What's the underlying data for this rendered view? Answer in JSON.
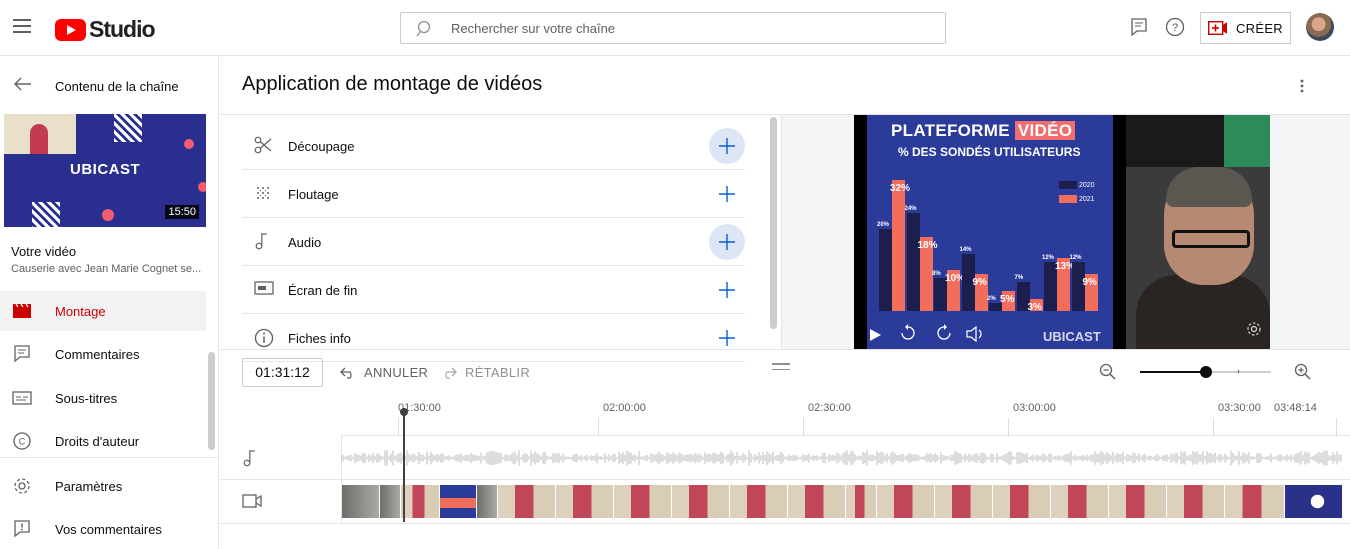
{
  "header": {
    "logo_text": "Studio",
    "search_placeholder": "Rechercher sur votre chaîne",
    "create_label": "CRÉER"
  },
  "sidebar": {
    "back_label": "Contenu de la chaîne",
    "thumbnail": {
      "logo_text": "UBICAST",
      "duration": "15:50"
    },
    "video_label": "Votre vidéo",
    "video_name": "Causerie avec Jean Marie Cognet se...",
    "items": [
      {
        "label": "Montage",
        "icon": "clapper-icon",
        "active": true
      },
      {
        "label": "Commentaires",
        "icon": "comment-icon"
      },
      {
        "label": "Sous-titres",
        "icon": "subtitles-icon"
      },
      {
        "label": "Droits d'auteur",
        "icon": "copyright-icon"
      },
      {
        "label": "Paramètres",
        "icon": "gear-icon"
      },
      {
        "label": "Vos commentaires",
        "icon": "feedback-icon"
      }
    ]
  },
  "main": {
    "title": "Application de montage de vidéos",
    "tools": [
      {
        "label": "Découpage",
        "icon": "scissors-icon",
        "highlighted": true
      },
      {
        "label": "Floutage",
        "icon": "blur-icon",
        "highlighted": false
      },
      {
        "label": "Audio",
        "icon": "music-note-icon",
        "highlighted": true
      },
      {
        "label": "Écran de fin",
        "icon": "end-screen-icon",
        "highlighted": false
      },
      {
        "label": "Fiches info",
        "icon": "info-icon",
        "highlighted": false
      }
    ]
  },
  "preview": {
    "slide_title_a": "PLATEFORME",
    "slide_title_b": "VIDÉO",
    "slide_subtitle": "% DES SONDÉS UTILISATEURS",
    "legend": [
      "2020",
      "2021"
    ],
    "bars": [
      {
        "v2020": 20,
        "v2021": 32
      },
      {
        "v2020": 24,
        "v2021": 18
      },
      {
        "v2020": 8,
        "v2021": 10
      },
      {
        "v2020": 14,
        "v2021": 9
      },
      {
        "v2020": 2,
        "v2021": 5
      },
      {
        "v2020": 7,
        "v2021": 3
      },
      {
        "v2020": 12,
        "v2021": 13
      },
      {
        "v2020": 12,
        "v2021": 9
      }
    ],
    "watermark": "UBICAST"
  },
  "timeline": {
    "timecode": "01:31:12",
    "undo_label": "ANNULER",
    "redo_label": "RÉTABLIR",
    "zoom_level": 0.5,
    "ticks": [
      "01:30:00",
      "02:00:00",
      "02:30:00",
      "03:00:00",
      "03:30:00",
      "03:48:14"
    ]
  },
  "colors": {
    "brand_red": "#ff0000",
    "active_red": "#cc0000",
    "accent_blue": "#065fd4",
    "slide_blue": "#2b3b9a",
    "bar_2020": "#1c1f4d",
    "bar_2021": "#f26d5b"
  }
}
